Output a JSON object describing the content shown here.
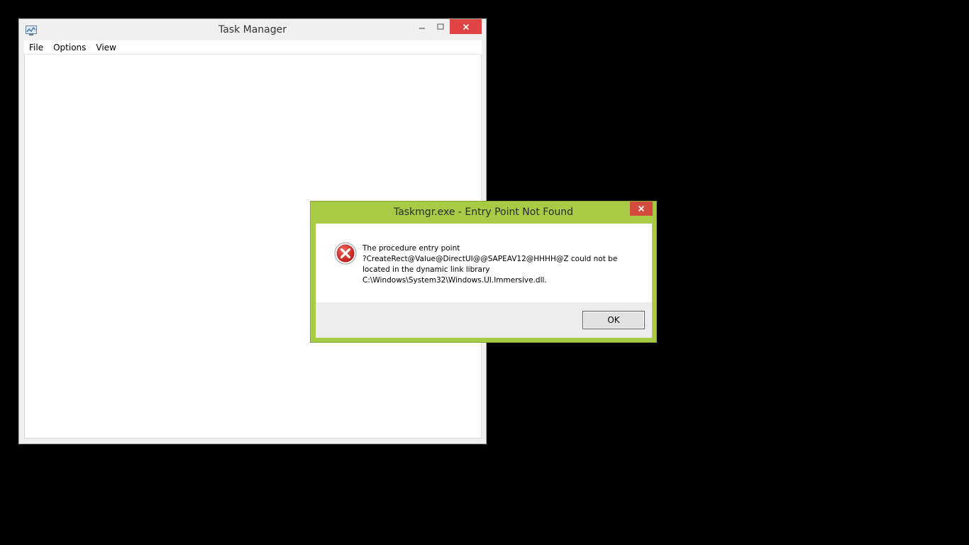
{
  "task_manager": {
    "title": "Task Manager",
    "app_icon": "task-manager-icon",
    "controls": {
      "minimize": "minimize-icon",
      "maximize": "maximize-icon",
      "close": "close-icon"
    },
    "menu": [
      {
        "label": "File"
      },
      {
        "label": "Options"
      },
      {
        "label": "View"
      }
    ]
  },
  "dialog": {
    "title": "Taskmgr.exe - Entry Point Not Found",
    "icon": "error-icon",
    "message_lines": [
      "The procedure entry point",
      "?CreateRect@Value@DirectUI@@SAPEAV12@HHHH@Z could not be",
      "located in the dynamic link library",
      "C:\\Windows\\System32\\Windows.UI.Immersive.dll."
    ],
    "ok_label": "OK"
  },
  "colors": {
    "desktop": "#000000",
    "dialog_frame": "#a7cb45",
    "close_red": "#e04343"
  }
}
